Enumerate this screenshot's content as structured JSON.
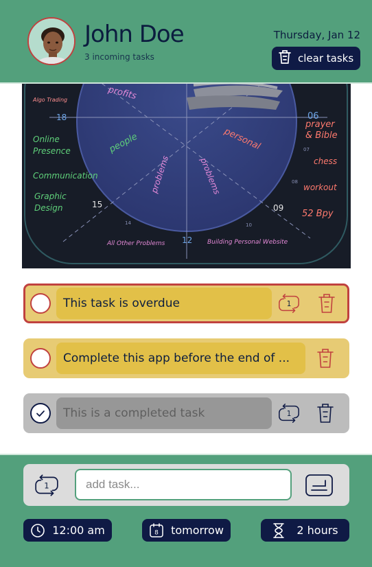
{
  "header": {
    "user_name": "John Doe",
    "task_count": "3 incoming tasks",
    "date": "Thursday, Jan 12",
    "clear_label": "clear tasks"
  },
  "photo": {
    "labels": [
      "Algo Trading",
      "profits",
      "18",
      "06",
      "prayer",
      "& Bible",
      "Online",
      "Presence",
      "people",
      "personal",
      "07",
      "chess",
      "Communication",
      "problems",
      "problems",
      "08",
      "workout",
      "Graphic",
      "Design",
      "15",
      "09",
      "52 Bpy",
      "14",
      "10",
      "All Other Problems",
      "12",
      "Building Personal Website"
    ]
  },
  "tasks": [
    {
      "text": "This task is overdue",
      "state": "overdue",
      "repeat": "1"
    },
    {
      "text": "Complete this app before the end of ...",
      "state": "pending"
    },
    {
      "text": "This is a completed task",
      "state": "completed",
      "repeat": "1"
    }
  ],
  "add_task": {
    "placeholder": "add task...",
    "repeat": "1"
  },
  "chips": {
    "time": "12:00 am",
    "day": "tomorrow",
    "day_icon_number": "8",
    "duration": "2 hours"
  },
  "colors": {
    "primary_green": "#53a07c",
    "navy": "#0f1a45",
    "overdue_red": "#c0413f",
    "task_yellow": "#e7cb74",
    "completed_gray": "#bcbcbc"
  }
}
